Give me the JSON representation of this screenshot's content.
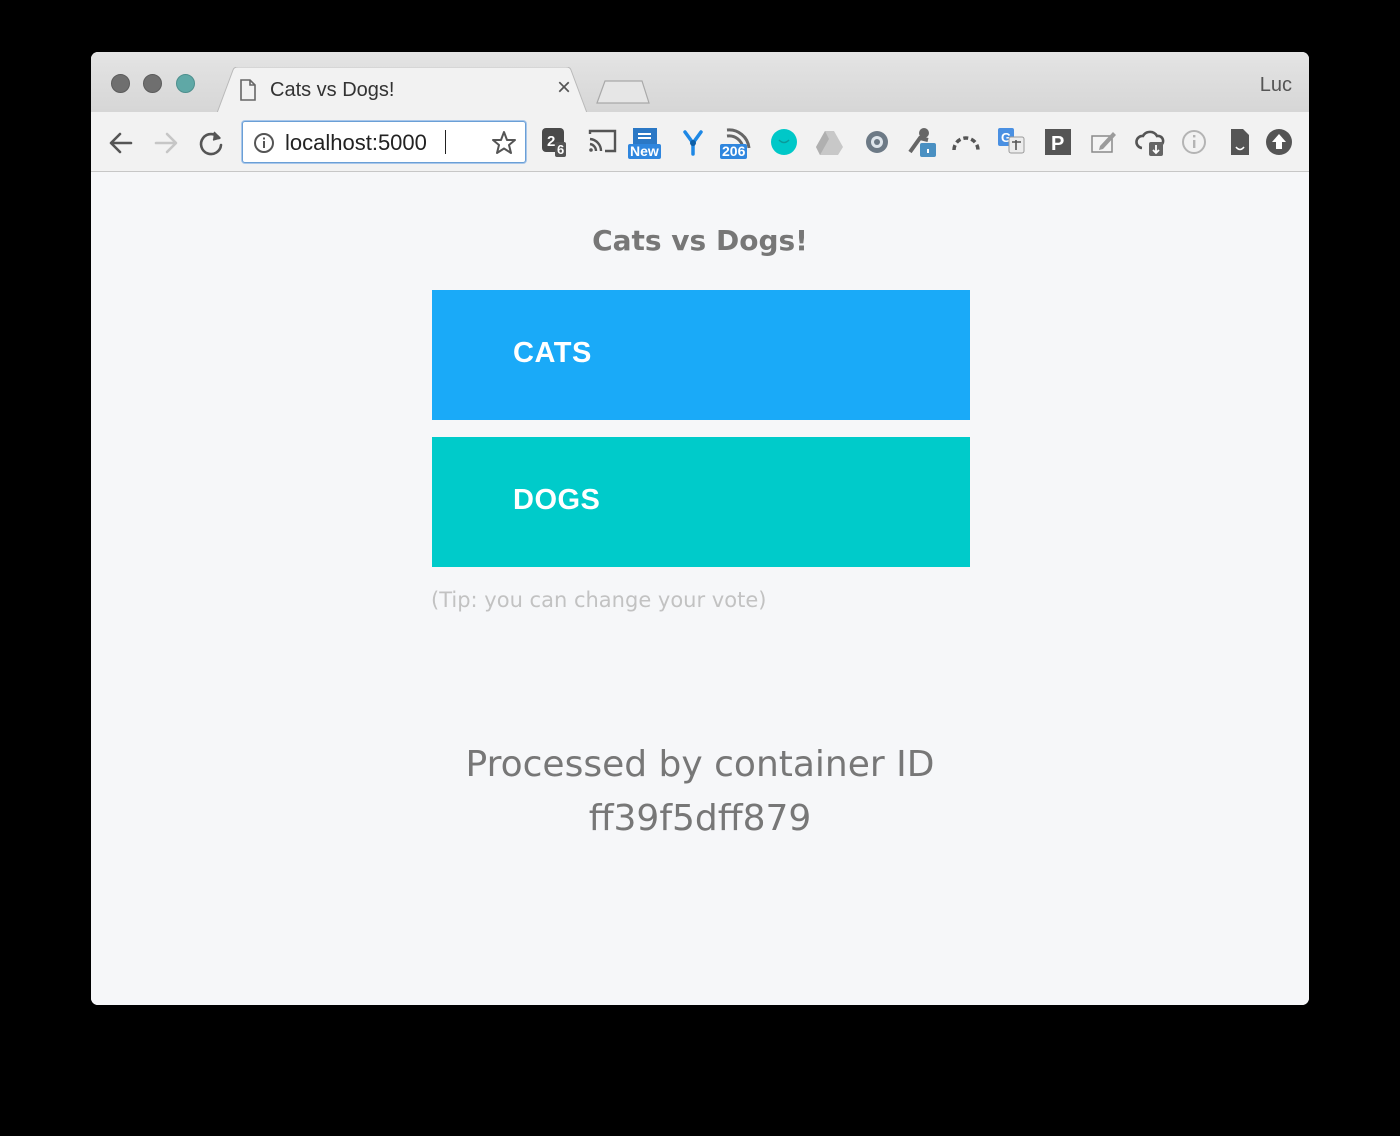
{
  "browser": {
    "tab_title": "Cats vs Dogs!",
    "profile_name": "Luc",
    "url": "localhost:5000",
    "extensions": [
      {
        "name": "counter-extension-icon",
        "badge": "6"
      },
      {
        "name": "cast-icon"
      },
      {
        "name": "new-extension-icon",
        "badge": "New"
      },
      {
        "name": "y-extension-icon"
      },
      {
        "name": "rss-feed-icon",
        "badge": "206"
      },
      {
        "name": "teal-circle-extension-icon"
      },
      {
        "name": "drive-icon"
      },
      {
        "name": "gear-extension-icon"
      },
      {
        "name": "person-lock-icon"
      },
      {
        "name": "arc-extension-icon"
      },
      {
        "name": "translate-icon"
      },
      {
        "name": "p-extension-icon"
      },
      {
        "name": "edit-extension-icon"
      },
      {
        "name": "cloud-download-icon"
      },
      {
        "name": "info-extension-icon"
      },
      {
        "name": "file-extension-icon"
      },
      {
        "name": "upload-circle-icon"
      }
    ]
  },
  "page": {
    "title": "Cats vs Dogs!",
    "options": [
      {
        "label": "CATS",
        "color": "#1aaaf8"
      },
      {
        "label": "DOGS",
        "color": "#00cbca"
      }
    ],
    "tip": "(Tip: you can change your vote)",
    "processed_label": "Processed by container ID",
    "container_id": "ff39f5dff879"
  },
  "colors": {
    "cats": "#1aaaf8",
    "dogs": "#00cbca",
    "text_gray": "#777777",
    "tip_gray": "#c2c2c2",
    "background": "#f6f7f9"
  }
}
